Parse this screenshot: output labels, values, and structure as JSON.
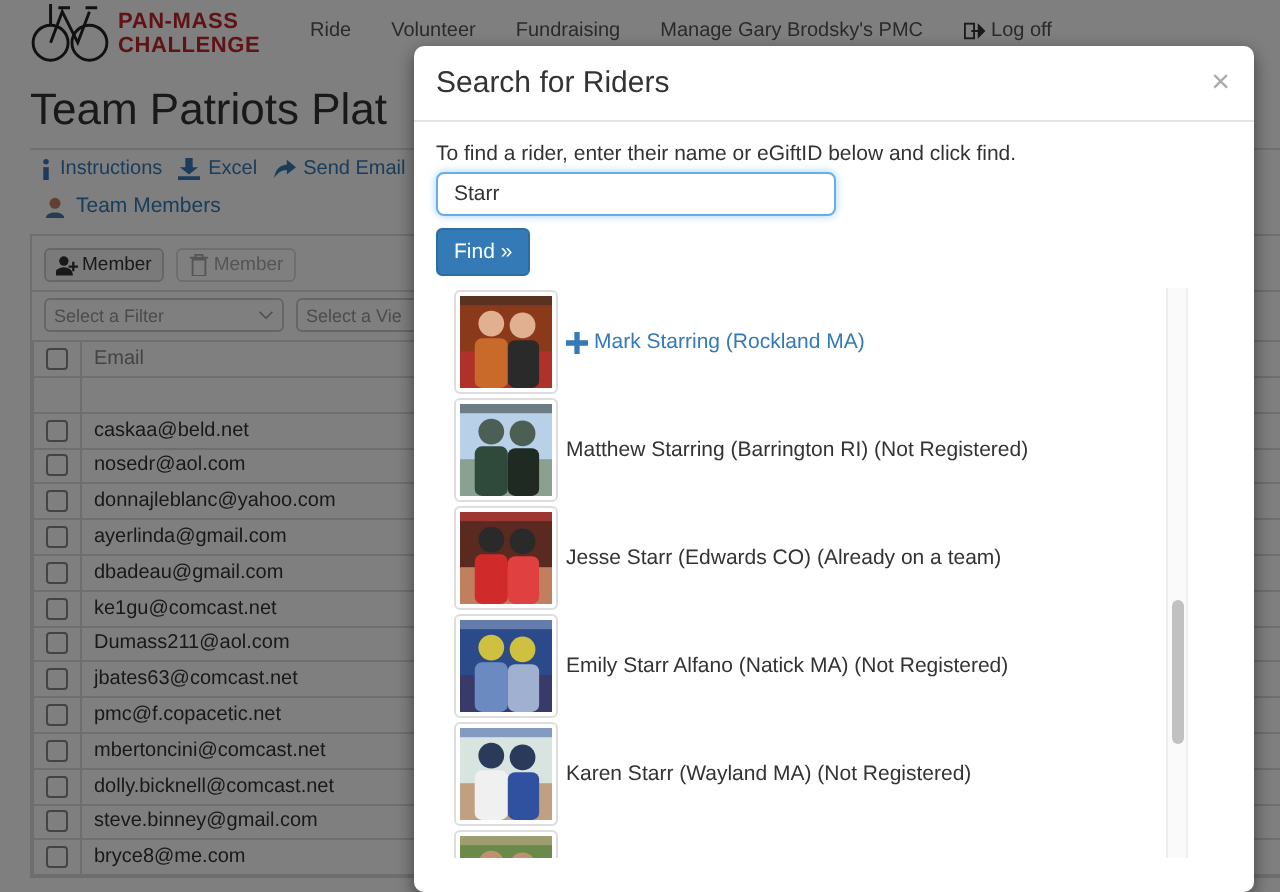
{
  "logo": {
    "line_1": "PAN-MASS",
    "line_2": "CHALLENGE"
  },
  "nav": [
    {
      "label": "Ride"
    },
    {
      "label": "Volunteer"
    },
    {
      "label": "Fundraising"
    },
    {
      "label": "Manage Gary Brodsky's PMC"
    },
    {
      "label": "Log off"
    }
  ],
  "page_title": "Team Patriots Plat",
  "actions": [
    {
      "label": "Instructions"
    },
    {
      "label": "Excel"
    },
    {
      "label": "Send Email"
    }
  ],
  "section": {
    "label": "Team Members"
  },
  "toolbar": [
    {
      "label": "Member",
      "disabled": false
    },
    {
      "label": "Member",
      "disabled": true
    }
  ],
  "filters": [
    {
      "placeholder": "Select a Filter"
    },
    {
      "placeholder": "Select a Vie"
    }
  ],
  "table": {
    "columns": [
      "Email"
    ],
    "all_checked": false,
    "rows": [
      {
        "email": "caskaa@beld.net",
        "checked": false
      },
      {
        "email": "nosedr@aol.com",
        "checked": false
      },
      {
        "email": "donnajleblanc@yahoo.com",
        "checked": false
      },
      {
        "email": "ayerlinda@gmail.com",
        "checked": false
      },
      {
        "email": "dbadeau@gmail.com",
        "checked": false
      },
      {
        "email": "ke1gu@comcast.net",
        "checked": false
      },
      {
        "email": "Dumass211@aol.com",
        "checked": false
      },
      {
        "email": "jbates63@comcast.net",
        "checked": false
      },
      {
        "email": "pmc@f.copacetic.net",
        "checked": false
      },
      {
        "email": "mbertoncini@comcast.net",
        "checked": false
      },
      {
        "email": "dolly.bicknell@comcast.net",
        "checked": false
      },
      {
        "email": "steve.binney@gmail.com",
        "checked": false
      },
      {
        "email": "bryce8@me.com",
        "checked": false
      }
    ]
  },
  "modal": {
    "title": "Search for Riders",
    "close": "×",
    "instructions": "To find a rider, enter their name or eGiftID below and click find.",
    "search_value": "Starr",
    "find_button": "Find »",
    "results": [
      {
        "kind": "rider",
        "name": "Mark Starring (Rockland MA)",
        "addable": true
      },
      {
        "kind": "rider",
        "name": "Matthew Starring (Barrington RI) (Not Registered)",
        "addable": false
      },
      {
        "kind": "rider",
        "name": "Jesse Starr (Edwards CO) (Already on a team)",
        "addable": false
      },
      {
        "kind": "rider",
        "name": "Emily Starr Alfano (Natick MA) (Not Registered)",
        "addable": false
      },
      {
        "kind": "rider",
        "name": "Karen Starr (Wayland MA) (Not Registered)",
        "addable": false
      },
      {
        "kind": "picture"
      }
    ]
  }
}
